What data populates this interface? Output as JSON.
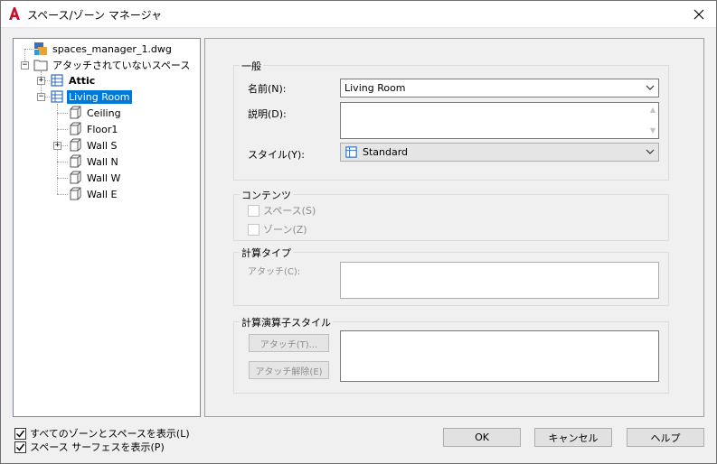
{
  "window": {
    "title": "スペース/ゾーン マネージャ"
  },
  "tree": {
    "root": {
      "label": "spaces_manager_1.dwg"
    },
    "unattached": {
      "label": "アタッチされていないスペース"
    },
    "attic": {
      "label": "Attic"
    },
    "living_room": {
      "label": "Living Room"
    },
    "children": [
      {
        "label": "Ceiling"
      },
      {
        "label": "Floor1"
      },
      {
        "label": "Wall S"
      },
      {
        "label": "Wall N"
      },
      {
        "label": "Wall W"
      },
      {
        "label": "Wall E"
      }
    ]
  },
  "general": {
    "title": "一般",
    "name_label": "名前(N):",
    "name_value": "Living Room",
    "description_label": "説明(D):",
    "description_value": "",
    "style_label": "スタイル(Y):",
    "style_value": "Standard"
  },
  "contents": {
    "title": "コンテンツ",
    "space_label": "スペース(S)",
    "zone_label": "ゾーン(Z)"
  },
  "calc_type": {
    "title": "計算タイプ",
    "attach_label": "アタッチ(C):"
  },
  "calc_modifier": {
    "title": "計算演算子スタイル",
    "attach_button": "アタッチ(T)...",
    "detach_button": "アタッチ解除(E)"
  },
  "options": {
    "show_all_label": "すべてのゾーンとスペースを表示(L)",
    "show_all_checked": true,
    "show_surfaces_label": "スペース サーフェスを表示(P)",
    "show_surfaces_checked": true
  },
  "buttons": {
    "ok": "OK",
    "cancel": "キャンセル",
    "help": "ヘルプ"
  },
  "colors": {
    "selection": "#0078d7",
    "app_icon": "#c8102e"
  }
}
